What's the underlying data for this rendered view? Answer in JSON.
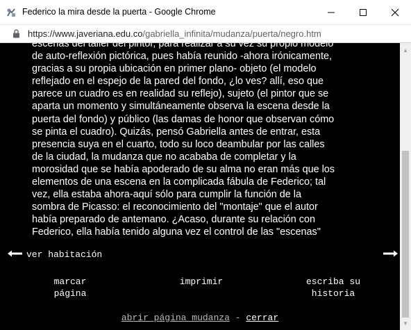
{
  "window": {
    "title": "Federico la mira desde la puerta - Google Chrome",
    "minimize_icon": "minimize-icon",
    "maximize_icon": "maximize-icon",
    "close_icon": "close-icon"
  },
  "address": {
    "url_host": "https://www.javeriana.edu.co",
    "url_path": "/gabriella_infinita/mudanza/puerta/negro.htm"
  },
  "article": {
    "lines": [
      "escenas del taller del pintor, para realizar a su vez su propio modelo",
      "de auto-reflexión pictórica, pues había reunido -ahora irónicamente,",
      "gracias a su propia ubicación en primer plano- objeto (el modelo",
      "reflejado en el espejo de la pared del fondo, ¿lo ves? allí, eso que",
      "parece un cuadro es en realidad su reflejo), sujeto (el pintor que se",
      "aparta un momento y simultáneamente observa la escena desde la",
      "puerta del fondo) y público (las damas de honor que observan cómo",
      "se pinta el cuadro). Quizás, pensó Gabriella antes de entrar, esta",
      "presencia suya en el cuarto, todo su loco deambular por las calles",
      "de la ciudad, la mudanza que no acababa de completar y la",
      "morosidad que se había apoderado de su alma no eran más que los",
      "elementos de una escena en la complicada fábula de Federico; tal",
      "vez, ella estaba ahora-aquí sólo para cumplir la función de la",
      "sombra de Picasso: el reconocimiento del \"montaje\" que el autor",
      "había preparado de antemano. ¿Acaso, durante su relación con",
      "Federico, ella había tenido alguna vez el control de las \"escenas\""
    ]
  },
  "nav": {
    "ver_habitacion": "ver habitación",
    "back_arrow_icon": "hand-arrow-left-icon",
    "forward_arrow_icon": "hand-arrow-right-icon"
  },
  "menu": {
    "marcar_line1": "marcar",
    "marcar_line2": "página",
    "imprimir": "imprimir",
    "escriba_line1": "escriba su",
    "escriba_line2": "historia"
  },
  "footer": {
    "abrir": "abrir página mudanza",
    "separator": "-",
    "cerrar": "cerrar"
  }
}
